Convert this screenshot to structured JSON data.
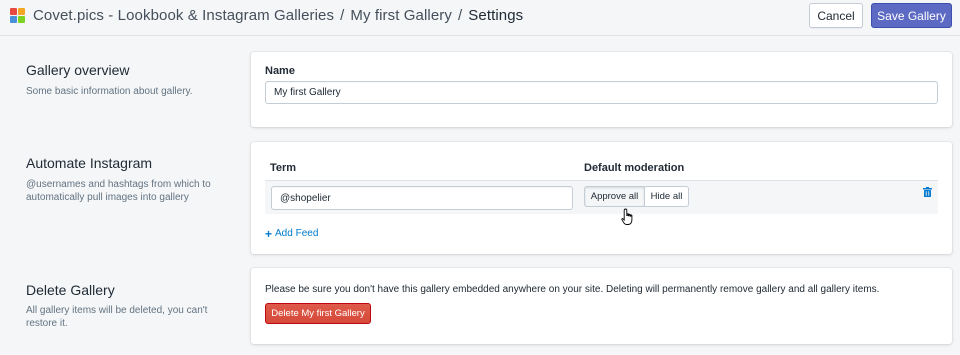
{
  "header": {
    "app_name": "Covet.pics - Lookbook & Instagram Galleries",
    "separator": "/",
    "gallery_crumb": "My first Gallery",
    "current_page": "Settings",
    "cancel_label": "Cancel",
    "save_label": "Save Gallery",
    "logo_colors": [
      "#e8493f",
      "#f5a623",
      "#4a90d9",
      "#7ed321"
    ]
  },
  "overview": {
    "title": "Gallery overview",
    "description": "Some basic information about gallery.",
    "name_label": "Name",
    "name_value": "My first Gallery"
  },
  "automate": {
    "title": "Automate Instagram",
    "description": "@usernames and hashtags from which to automatically pull images into gallery",
    "term_header": "Term",
    "moderation_header": "Default moderation",
    "feeds": [
      {
        "term": "@shopelier",
        "approve_label": "Approve all",
        "hide_label": "Hide all",
        "selected": "approve"
      }
    ],
    "add_feed_label": "Add Feed",
    "add_feed_icon": "plus-icon",
    "delete_icon": "trash-icon"
  },
  "delete": {
    "title": "Delete Gallery",
    "description": "All gallery items will be deleted, you can't restore it.",
    "warning": "Please be sure you don't have this gallery embedded anywhere on your site. Deleting will permanently remove gallery and all gallery items.",
    "button_label": "Delete My first Gallery"
  },
  "colors": {
    "primary": "#5c6ac4",
    "danger": "#d64a3a",
    "link": "#007ace",
    "background": "#f4f6f8"
  }
}
